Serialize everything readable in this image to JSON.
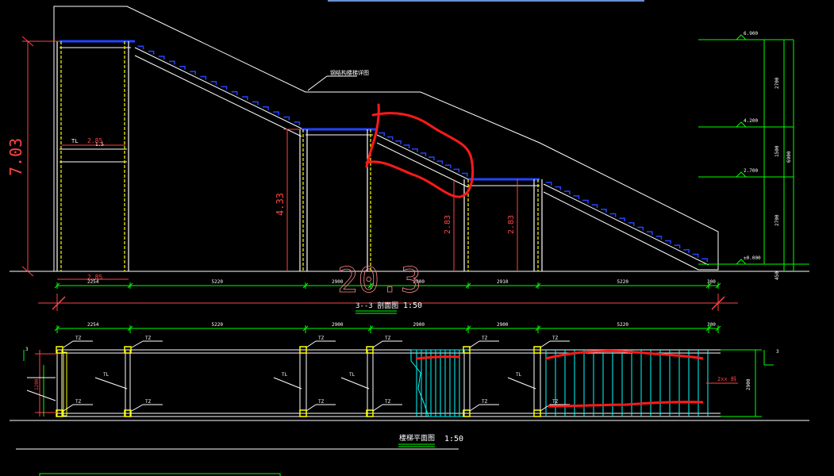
{
  "colors": {
    "background": "#000000",
    "outline": "#ffffff",
    "column": "#ffff00",
    "tread": "#0000ff",
    "dimension": "#00ff00",
    "red_dim": "#ff4444",
    "markup": "#ff0000",
    "cyan": "#00ffff"
  },
  "section_view": {
    "title": "3--3 剖面图",
    "scale": "1:50",
    "note": "钢结构楼梯详图",
    "total_height": "7.03",
    "mid_height": "4.33",
    "low_height_1": "2.83",
    "low_height_2": "2.83",
    "beam_label": "TL",
    "beam_dim": "2.85",
    "beam_dim_small": "1.5",
    "left_width": "2.85",
    "overlay_total": "20.3",
    "segment_dims": [
      "2254",
      "5220",
      "2900",
      "2900",
      "2910",
      "5220",
      "300"
    ],
    "level_marks": [
      "6.900",
      "4.200",
      "2.700",
      "±0.000"
    ],
    "level_dims": [
      "2700",
      "1500",
      "2700",
      "6900"
    ],
    "level_small": "450"
  },
  "plan_view": {
    "title": "楼梯平面图",
    "scale": "1:50",
    "segment_dims": [
      "2254",
      "5220",
      "2900",
      "2900",
      "2900",
      "5220",
      "300"
    ],
    "column_label": "TZ",
    "beam_label": "TL",
    "width_dim": "2900",
    "width_small": "3",
    "left_dims": [
      "1200",
      "1200"
    ],
    "slope_note": "2xx 斜",
    "left_mark": "3"
  }
}
